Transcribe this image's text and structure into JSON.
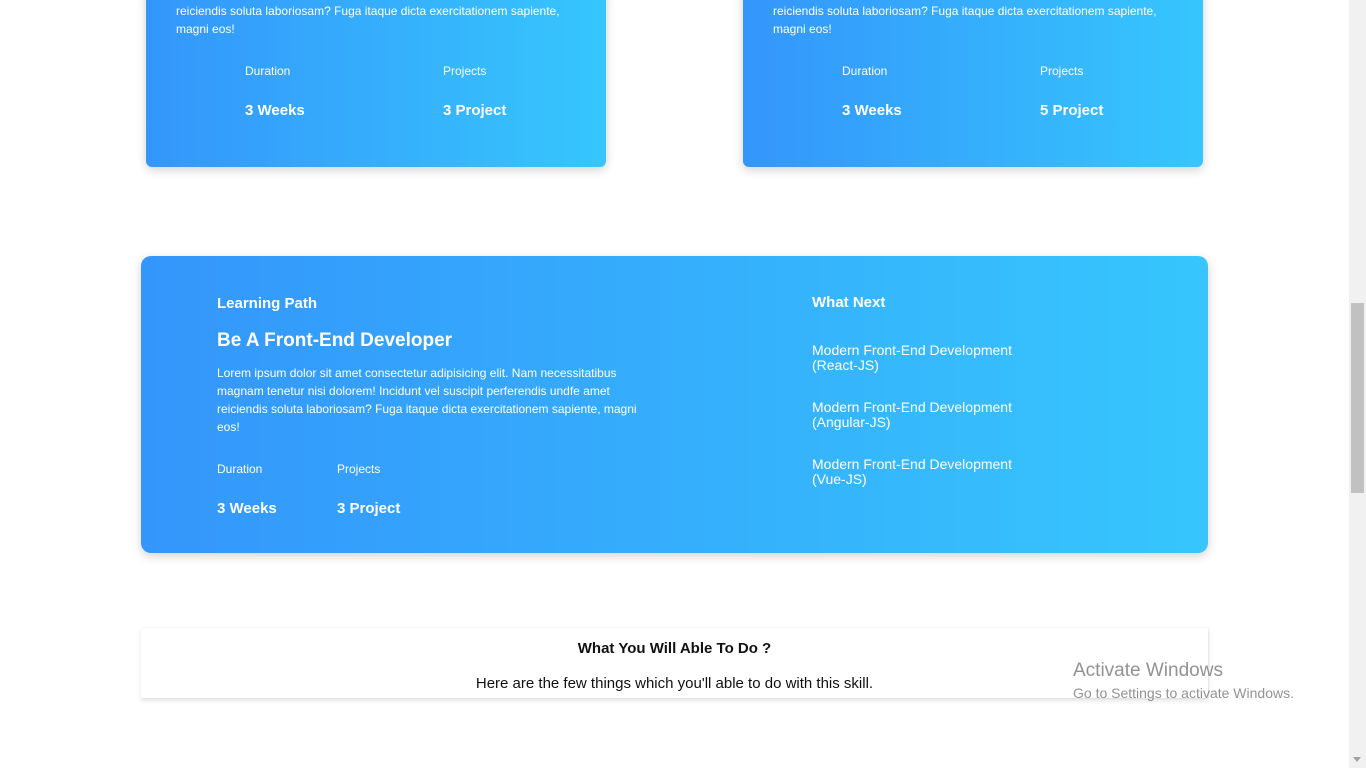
{
  "top_cards": [
    {
      "description": "reiciendis soluta laboriosam? Fuga itaque dicta exercitationem sapiente, magni eos!",
      "duration_label": "Duration",
      "duration_value": "3 Weeks",
      "projects_label": "Projects",
      "projects_value": "3 Project"
    },
    {
      "description": "reiciendis soluta laboriosam? Fuga itaque dicta exercitationem sapiente, magni eos!",
      "duration_label": "Duration",
      "duration_value": "3 Weeks",
      "projects_label": "Projects",
      "projects_value": "5 Project"
    }
  ],
  "learning_path": {
    "heading": "Learning Path",
    "title": "Be A Front-End Developer",
    "description": "Lorem ipsum dolor sit amet consectetur adipisicing elit. Nam necessitatibus magnam tenetur nisi dolorem! Incidunt vel suscipit perferendis undfe amet reiciendis soluta laboriosam? Fuga itaque dicta exercitationem sapiente, magni eos!",
    "duration_label": "Duration",
    "duration_value": "3 Weeks",
    "projects_label": "Projects",
    "projects_value": "3 Project"
  },
  "what_next": {
    "heading": "What Next",
    "items": [
      "Modern Front-End Development (React-JS)",
      "Modern Front-End Development (Angular-JS)",
      "Modern Front-End Development (Vue-JS)"
    ]
  },
  "able_section": {
    "title": "What You Will Able To Do ?",
    "subtitle": "Here are the few things which you'll able to do with this skill."
  },
  "watermark": {
    "line1": "Activate Windows",
    "line2": "Go to Settings to activate Windows."
  },
  "colors": {
    "gradient_start": "#3496fb",
    "gradient_end": "#36c6fd"
  }
}
